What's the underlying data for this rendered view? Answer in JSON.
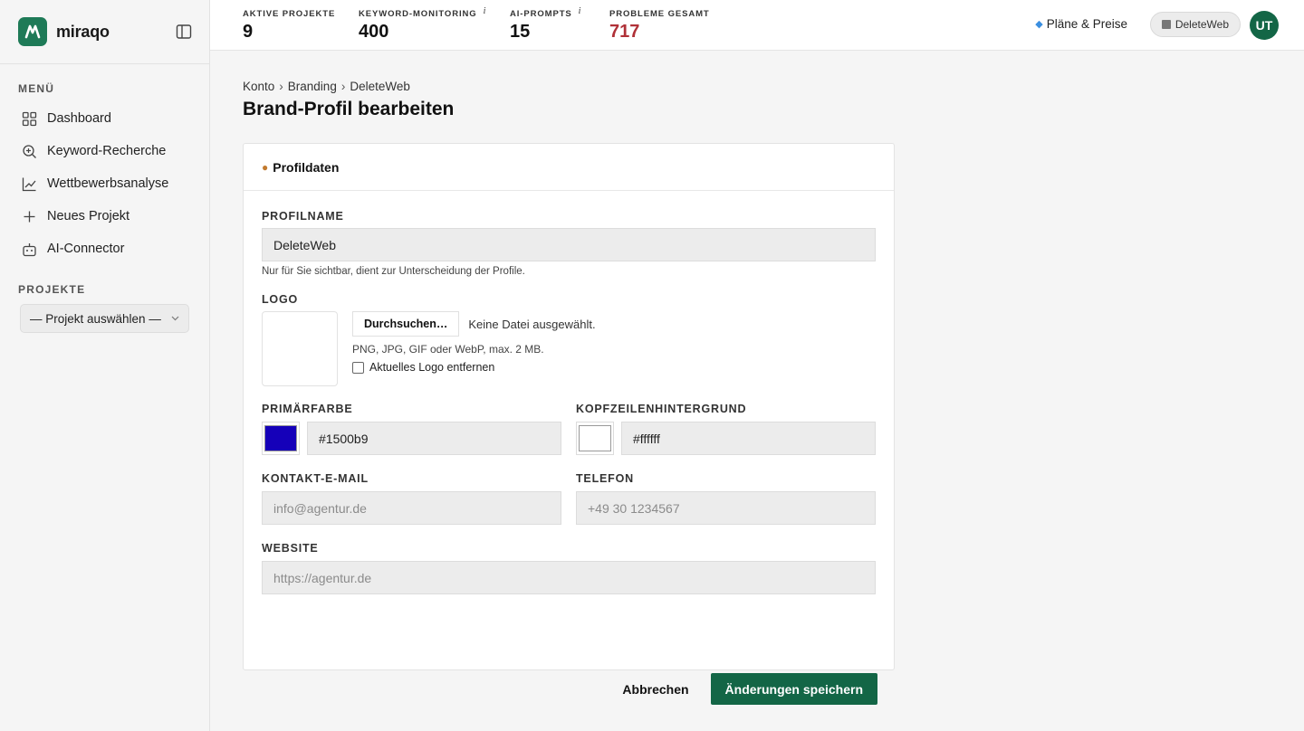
{
  "app": {
    "name": "miraqo"
  },
  "sidebar": {
    "menu_title": "MENÜ",
    "items": [
      {
        "label": "Dashboard",
        "icon": "grid-icon"
      },
      {
        "label": "Keyword-Recherche",
        "icon": "search-icon"
      },
      {
        "label": "Wettbewerbsanalyse",
        "icon": "chart-line-icon"
      },
      {
        "label": "Neues Projekt",
        "icon": "plus-icon"
      },
      {
        "label": "AI-Connector",
        "icon": "robot-icon"
      }
    ],
    "projects_title": "PROJEKTE",
    "project_select": "— Projekt auswählen —"
  },
  "topbar": {
    "stats": [
      {
        "label": "AKTIVE PROJEKTE",
        "value": "9",
        "info": ""
      },
      {
        "label": "KEYWORD-MONITORING",
        "value": "400",
        "info": "i"
      },
      {
        "label": "AI-PROMPTS",
        "value": "15",
        "info": "i"
      },
      {
        "label": "PROBLEME GESAMT",
        "value": "717",
        "info": ""
      }
    ],
    "plans_label": "Pläne & Preise",
    "workspace_label": "DeleteWeb",
    "avatar_initials": "UT"
  },
  "breadcrumb": {
    "items": [
      "Konto",
      "Branding",
      "DeleteWeb"
    ],
    "separator": "›"
  },
  "page_title": "Brand-Profil bearbeiten",
  "card": {
    "title": "Profildaten",
    "profile_name": {
      "label": "PROFILNAME",
      "value": "DeleteWeb",
      "hint": "Nur für Sie sichtbar, dient zur Unterscheidung der Profile."
    },
    "logo": {
      "label": "LOGO",
      "browse_label": "Durchsuchen…",
      "no_file": "Keine Datei ausgewählt.",
      "formats_hint": "PNG, JPG, GIF oder WebP, max. 2 MB.",
      "remove_label": "Aktuelles Logo entfernen"
    },
    "primary_color": {
      "label": "PRIMÄRFARBE",
      "value": "#1500b9",
      "swatch": "#1500b9"
    },
    "header_bg": {
      "label": "KOPFZEILENHINTERGRUND",
      "value": "#ffffff",
      "swatch": "#ffffff"
    },
    "email": {
      "label": "KONTAKT-E-MAIL",
      "placeholder": "info@agentur.de"
    },
    "phone": {
      "label": "TELEFON",
      "placeholder": "+49 30 1234567"
    },
    "website": {
      "label": "WEBSITE",
      "placeholder": "https://agentur.de"
    },
    "cancel_label": "Abbrechen",
    "save_label": "Änderungen speichern"
  },
  "colors": {
    "accent": "#136646",
    "danger": "#b03138"
  }
}
